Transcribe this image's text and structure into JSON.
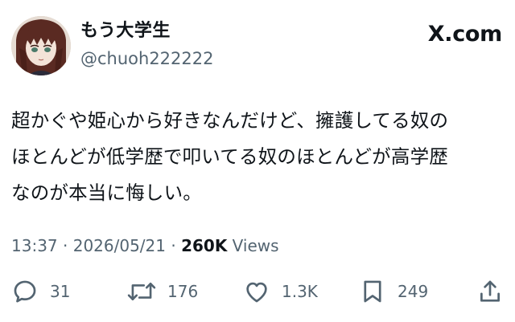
{
  "author": {
    "display_name": "もう大学生",
    "handle": "@chuoh222222"
  },
  "brand": "X.com",
  "tweet": {
    "text": "超かぐや姫心から好きなんだけど、擁護してる奴の\nほとんどが低学歴で叩いてる奴のほとんどが高学歴\nなのが本当に悔しい。"
  },
  "meta": {
    "time": "13:37",
    "separator": " · ",
    "date": "2026/05/21",
    "views_count": "260K",
    "views_label": " Views"
  },
  "actions": {
    "replies": "31",
    "reposts": "176",
    "likes": "1.3K",
    "bookmarks": "249"
  },
  "icons": {
    "reply": "reply-icon",
    "repost": "repost-icon",
    "like": "heart-icon",
    "bookmark": "bookmark-icon",
    "share": "share-icon"
  },
  "colors": {
    "text": "#0f1419",
    "secondary": "#536471",
    "background": "#ffffff"
  }
}
